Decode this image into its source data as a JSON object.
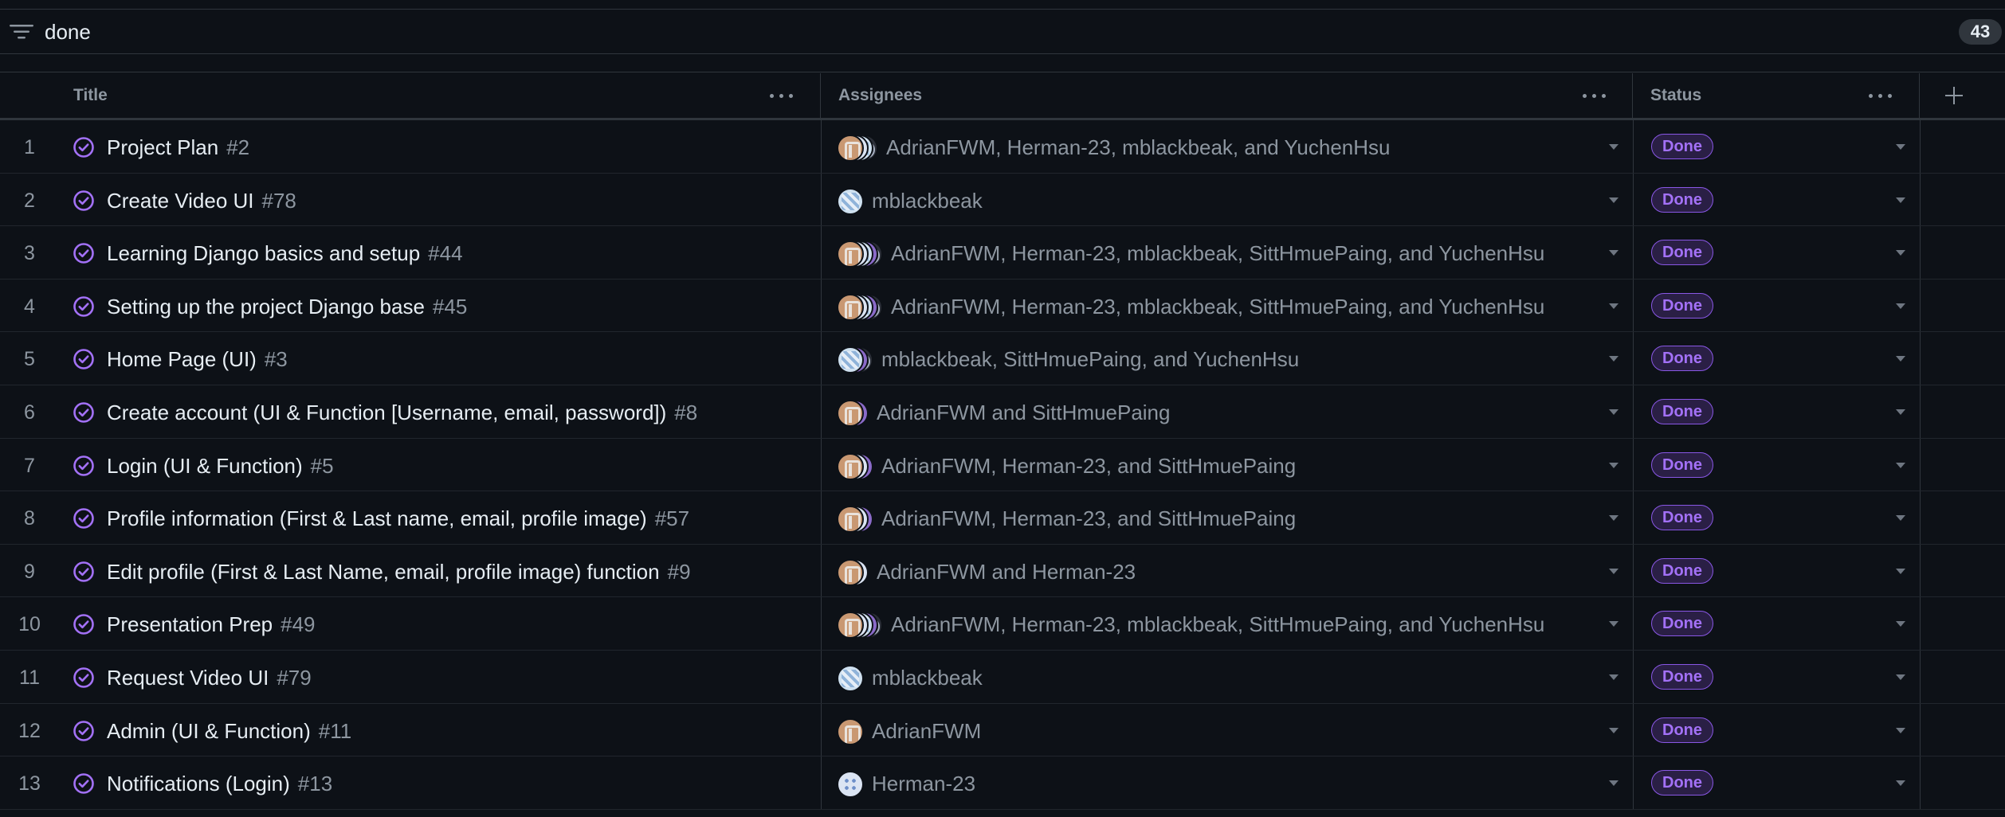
{
  "filter": {
    "query": "done",
    "count": "43"
  },
  "columns": {
    "title": "Title",
    "assignees": "Assignees",
    "status": "Status"
  },
  "colors": {
    "accent": "#a371f7",
    "background": "#0d1117",
    "border": "#30363d",
    "muted_text": "#8d96a0"
  },
  "rows": [
    {
      "num": "1",
      "title": "Project Plan",
      "issue": "#2",
      "avatars": [
        "adrian",
        "herman",
        "mblack",
        "yuchen"
      ],
      "assignees": "AdrianFWM, Herman-23, mblackbeak, and YuchenHsu",
      "status": "Done"
    },
    {
      "num": "2",
      "title": "Create Video UI",
      "issue": "#78",
      "avatars": [
        "mblack"
      ],
      "assignees": "mblackbeak",
      "status": "Done"
    },
    {
      "num": "3",
      "title": "Learning Django basics and setup",
      "issue": "#44",
      "avatars": [
        "adrian",
        "herman",
        "mblack",
        "sitt",
        "yuchen"
      ],
      "assignees": "AdrianFWM, Herman-23, mblackbeak, SittHmuePaing, and YuchenHsu",
      "status": "Done"
    },
    {
      "num": "4",
      "title": "Setting up the project Django base",
      "issue": "#45",
      "avatars": [
        "adrian",
        "herman",
        "mblack",
        "sitt",
        "yuchen"
      ],
      "assignees": "AdrianFWM, Herman-23, mblackbeak, SittHmuePaing, and YuchenHsu",
      "status": "Done"
    },
    {
      "num": "5",
      "title": "Home Page (UI)",
      "issue": "#3",
      "avatars": [
        "mblack",
        "sitt",
        "yuchen"
      ],
      "assignees": "mblackbeak, SittHmuePaing, and YuchenHsu",
      "status": "Done"
    },
    {
      "num": "6",
      "title": "Create account (UI & Function [Username, email, password])",
      "issue": "#8",
      "avatars": [
        "adrian",
        "sitt"
      ],
      "assignees": "AdrianFWM and SittHmuePaing",
      "status": "Done"
    },
    {
      "num": "7",
      "title": "Login (UI & Function)",
      "issue": "#5",
      "avatars": [
        "adrian",
        "herman",
        "sitt"
      ],
      "assignees": "AdrianFWM, Herman-23, and SittHmuePaing",
      "status": "Done"
    },
    {
      "num": "8",
      "title": "Profile information (First & Last name, email, profile image)",
      "issue": "#57",
      "avatars": [
        "adrian",
        "herman",
        "sitt"
      ],
      "assignees": "AdrianFWM, Herman-23, and SittHmuePaing",
      "status": "Done"
    },
    {
      "num": "9",
      "title": "Edit profile (First & Last Name, email, profile image) function",
      "issue": "#9",
      "avatars": [
        "adrian",
        "herman"
      ],
      "assignees": "AdrianFWM and Herman-23",
      "status": "Done"
    },
    {
      "num": "10",
      "title": "Presentation Prep",
      "issue": "#49",
      "avatars": [
        "adrian",
        "herman",
        "mblack",
        "sitt",
        "yuchen"
      ],
      "assignees": "AdrianFWM, Herman-23, mblackbeak, SittHmuePaing, and YuchenHsu",
      "status": "Done"
    },
    {
      "num": "11",
      "title": "Request Video UI",
      "issue": "#79",
      "avatars": [
        "mblack"
      ],
      "assignees": "mblackbeak",
      "status": "Done"
    },
    {
      "num": "12",
      "title": "Admin (UI & Function)",
      "issue": "#11",
      "avatars": [
        "adrian"
      ],
      "assignees": "AdrianFWM",
      "status": "Done"
    },
    {
      "num": "13",
      "title": "Notifications (Login)",
      "issue": "#13",
      "avatars": [
        "herman"
      ],
      "assignees": "Herman-23",
      "status": "Done"
    }
  ]
}
